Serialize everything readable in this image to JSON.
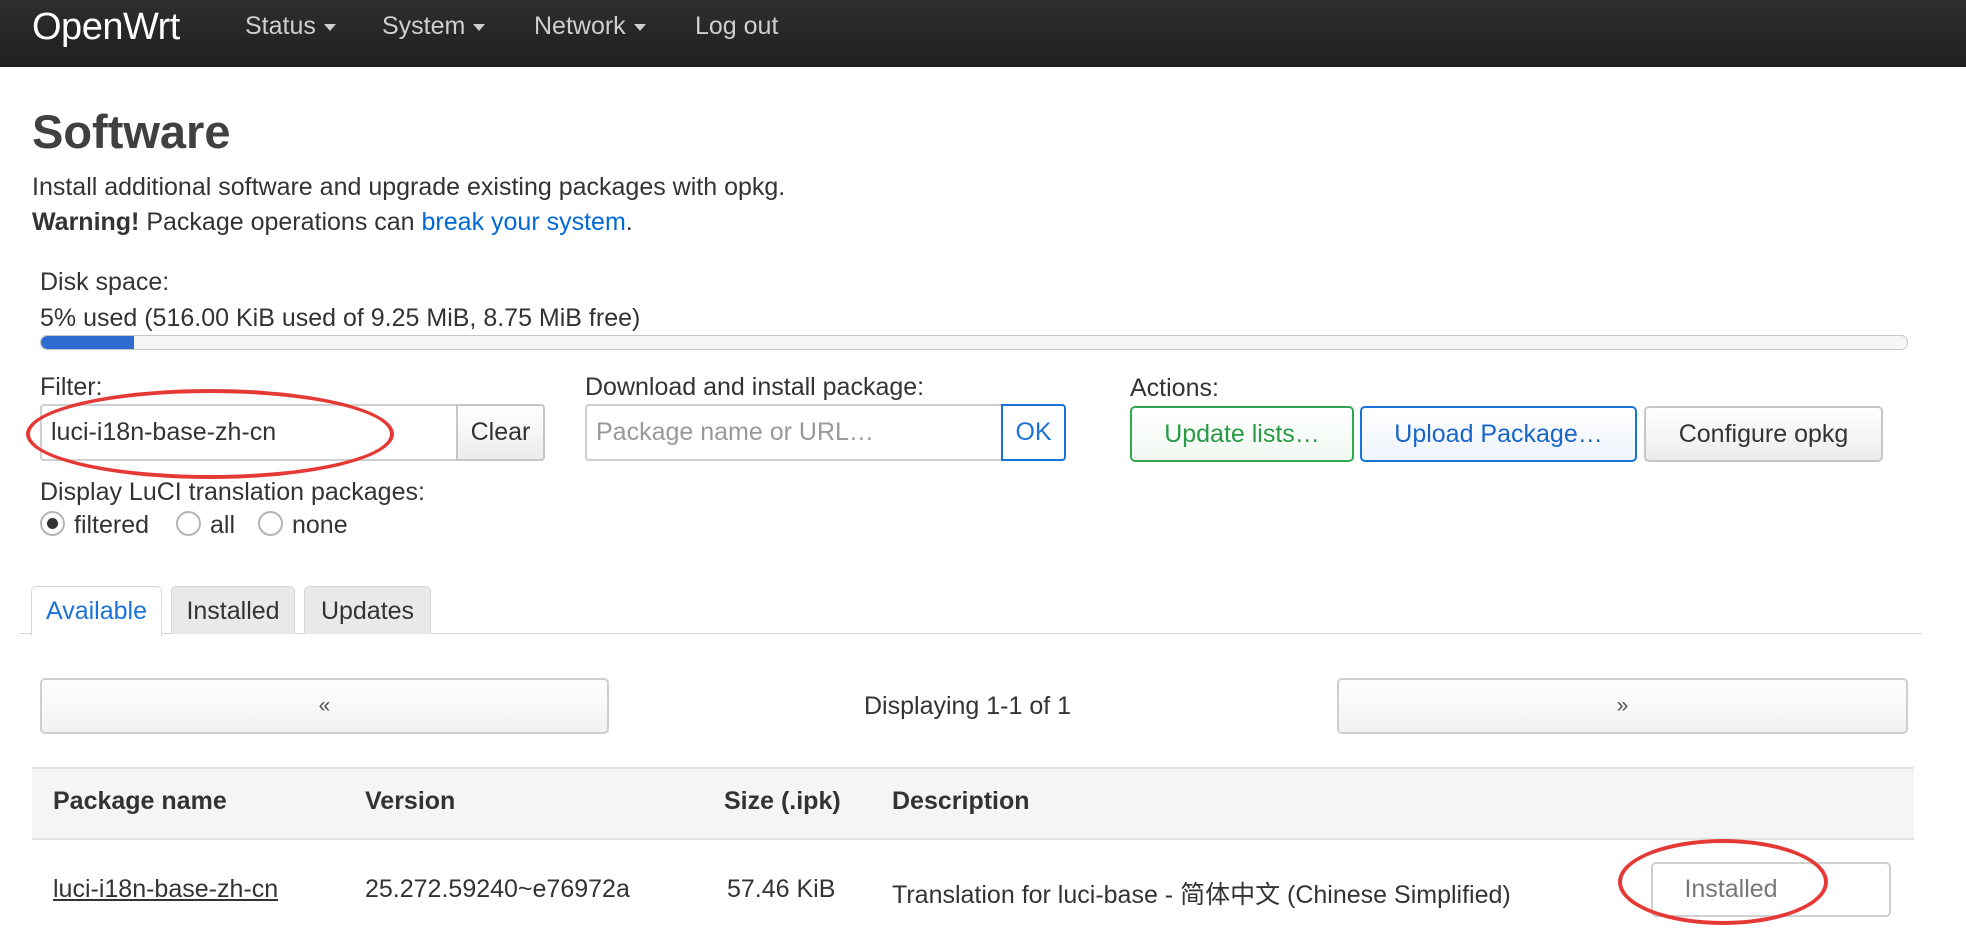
{
  "navbar": {
    "brand": "OpenWrt",
    "items": [
      {
        "label": "Status"
      },
      {
        "label": "System"
      },
      {
        "label": "Network"
      },
      {
        "label": "Log out"
      }
    ]
  },
  "page": {
    "title": "Software",
    "description": "Install additional software and upgrade existing packages with opkg.",
    "warning_bold": "Warning!",
    "warning_text": " Package operations can ",
    "warning_link": "break your system",
    "warning_end": "."
  },
  "disk": {
    "label": "Disk space:",
    "usage_text": "5% used (516.00 KiB used of 9.25 MiB, 8.75 MiB free)",
    "used_fraction": 0.05
  },
  "filter": {
    "label": "Filter:",
    "value": "luci-i18n-base-zh-cn",
    "clear_label": "Clear"
  },
  "download": {
    "label": "Download and install package:",
    "placeholder": "Package name or URL…",
    "ok_label": "OK"
  },
  "actions": {
    "label": "Actions:",
    "update_lists": "Update lists…",
    "upload_package": "Upload Package…",
    "configure_opkg": "Configure opkg"
  },
  "translation_display": {
    "label": "Display LuCI translation packages:",
    "options": [
      "filtered",
      "all",
      "none"
    ],
    "selected": "filtered"
  },
  "tabs": [
    "Available",
    "Installed",
    "Updates"
  ],
  "active_tab": "Available",
  "pager": {
    "prev": "«",
    "next": "»",
    "status": "Displaying 1-1 of 1"
  },
  "table": {
    "headers": [
      "Package name",
      "Version",
      "Size (.ipk)",
      "Description"
    ],
    "rows": [
      {
        "name": "luci-i18n-base-zh-cn",
        "version": "25.272.59240~e76972a",
        "size": "57.46 KiB",
        "description": "Translation for luci-base - 简体中文 (Chinese Simplified)",
        "action": "Installed"
      }
    ]
  },
  "colors": {
    "navbar": "#222222",
    "link": "#0069d6",
    "progress_fill": "#2d6bd1",
    "success": "#32a852",
    "primary": "#1a73d9",
    "annotation": "#e53935"
  }
}
